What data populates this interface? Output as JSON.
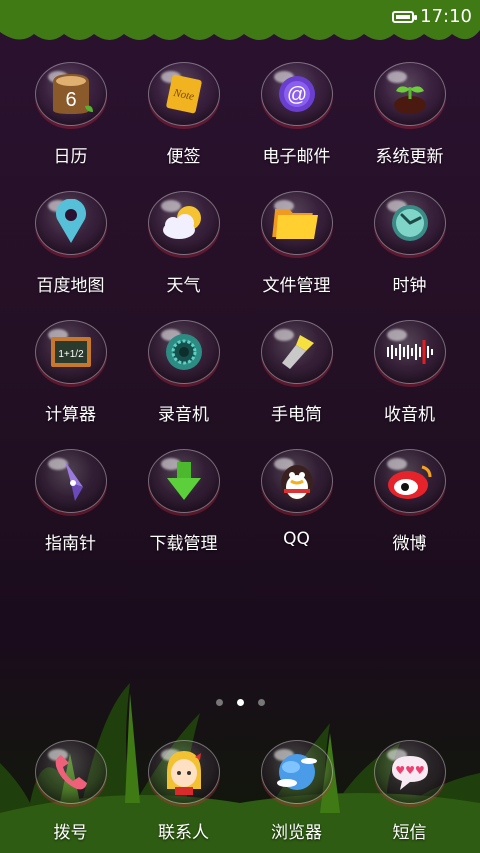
{
  "status_bar": {
    "time": "17:10"
  },
  "apps": [
    {
      "label": "日历",
      "icon": "calendar-icon",
      "name": "app-calendar"
    },
    {
      "label": "便签",
      "icon": "note-icon",
      "name": "app-notes"
    },
    {
      "label": "电子邮件",
      "icon": "email-icon",
      "name": "app-email"
    },
    {
      "label": "系统更新",
      "icon": "sprout-icon",
      "name": "app-system-update"
    },
    {
      "label": "百度地图",
      "icon": "map-pin-icon",
      "name": "app-baidu-map"
    },
    {
      "label": "天气",
      "icon": "weather-icon",
      "name": "app-weather"
    },
    {
      "label": "文件管理",
      "icon": "folder-icon",
      "name": "app-file-manager"
    },
    {
      "label": "时钟",
      "icon": "clock-icon",
      "name": "app-clock"
    },
    {
      "label": "计算器",
      "icon": "chalkboard-icon",
      "name": "app-calculator"
    },
    {
      "label": "录音机",
      "icon": "recorder-icon",
      "name": "app-recorder"
    },
    {
      "label": "手电筒",
      "icon": "flashlight-icon",
      "name": "app-flashlight"
    },
    {
      "label": "收音机",
      "icon": "radio-icon",
      "name": "app-radio"
    },
    {
      "label": "指南针",
      "icon": "compass-icon",
      "name": "app-compass"
    },
    {
      "label": "下载管理",
      "icon": "download-icon",
      "name": "app-download-manager"
    },
    {
      "label": "QQ",
      "icon": "penguin-icon",
      "name": "app-qq"
    },
    {
      "label": "微博",
      "icon": "weibo-icon",
      "name": "app-weibo"
    }
  ],
  "calendar_day": "6",
  "note_text": "Note",
  "calc_text": "1+1/2",
  "dock": [
    {
      "label": "拨号",
      "icon": "phone-icon",
      "name": "dock-dialer"
    },
    {
      "label": "联系人",
      "icon": "contact-girl-icon",
      "name": "dock-contacts"
    },
    {
      "label": "浏览器",
      "icon": "globe-icon",
      "name": "dock-browser"
    },
    {
      "label": "短信",
      "icon": "message-icon",
      "name": "dock-messages"
    }
  ],
  "page_indicator": {
    "count": 3,
    "active_index": 1
  },
  "colors": {
    "accent_green": "#3f7a14",
    "background": "#241025"
  }
}
